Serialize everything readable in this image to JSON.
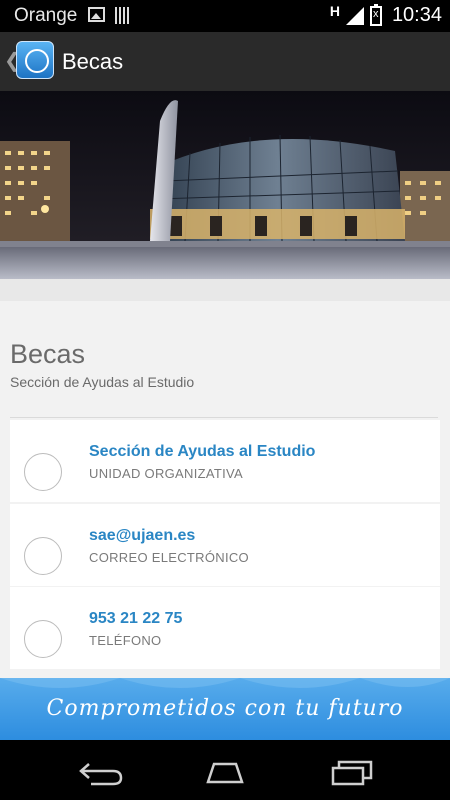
{
  "status_bar": {
    "carrier": "Orange",
    "network_type": "H",
    "time": "10:34",
    "icons": [
      "picture-icon",
      "barcode-icon",
      "signal-icon",
      "battery-icon"
    ]
  },
  "action_bar": {
    "title": "Becas",
    "icons": [
      "back-chevron-icon",
      "app-logo-icon"
    ]
  },
  "page": {
    "title": "Becas",
    "subtitle": "Sección de Ayudas al Estudio"
  },
  "cards": [
    {
      "title": "Sección de Ayudas al Estudio",
      "subtitle": "UNIDAD ORGANIZATIVA"
    },
    {
      "title": "sae@ujaen.es",
      "subtitle": "CORREO ELECTRÓNICO"
    },
    {
      "title": "953 21 22 75",
      "subtitle": "TELÉFONO"
    }
  ],
  "banner": {
    "text": "Comprometidos con tu futuro"
  },
  "nav_bar": {
    "icons": [
      "back-icon",
      "home-icon",
      "recent-apps-icon"
    ]
  },
  "colors": {
    "accent": "#2a86c4",
    "banner": "#3d9be6",
    "action_bar": "#2a2a2a"
  }
}
